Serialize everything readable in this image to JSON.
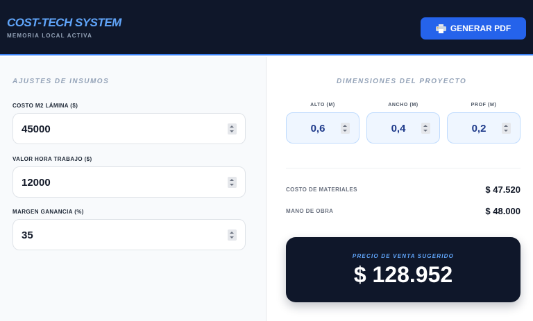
{
  "header": {
    "title": "COST-TECH SYSTEM",
    "subtitle": "MEMORIA LOCAL ACTIVA",
    "pdf_button": "GENERAR PDF"
  },
  "supplies": {
    "section_title": "AJUSTES DE INSUMOS",
    "fields": [
      {
        "label": "COSTO M2 LÁMINA ($)",
        "value": "45000"
      },
      {
        "label": "VALOR HORA TRABAJO ($)",
        "value": "12000"
      },
      {
        "label": "MARGEN GANANCIA (%)",
        "value": "35"
      }
    ]
  },
  "dimensions": {
    "section_title": "DIMENSIONES DEL PROYECTO",
    "fields": [
      {
        "label": "ALTO (M)",
        "value": "0,6"
      },
      {
        "label": "ANCHO (M)",
        "value": "0,4"
      },
      {
        "label": "PROF (M)",
        "value": "0,2"
      }
    ]
  },
  "costs": [
    {
      "label": "COSTO DE MATERIALES",
      "value": "$ 47.520"
    },
    {
      "label": "MANO DE OBRA",
      "value": "$ 48.000"
    }
  ],
  "price": {
    "label": "PRECIO DE VENTA SUGERIDO",
    "value": "$ 128.952"
  },
  "colors": {
    "header_bg": "#0f172a",
    "accent": "#2563eb",
    "title_blue": "#60a5fa",
    "dim_bg": "#eff6ff"
  }
}
